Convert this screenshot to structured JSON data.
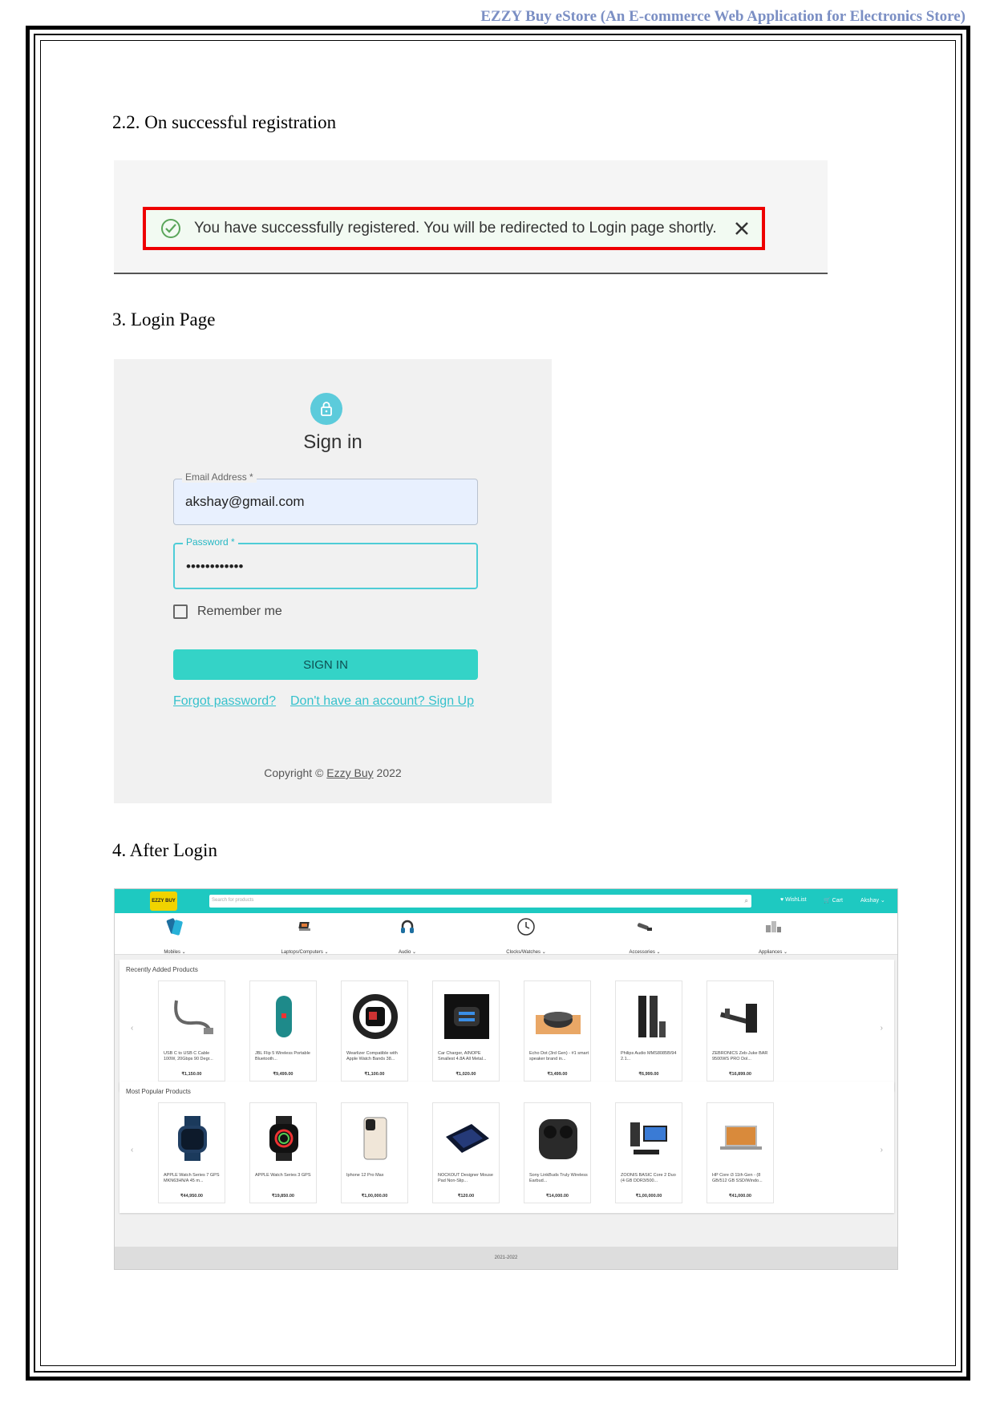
{
  "header": {
    "running_title": "EZZY Buy eStore (An E-commerce Web Application for Electronics Store)"
  },
  "sections": {
    "registration": {
      "heading": "2.2. On successful registration",
      "alert_message": "You have successfully registered. You will be redirected to Login page shortly."
    },
    "login": {
      "heading": "3. Login Page",
      "title": "Sign in",
      "email_label": "Email Address *",
      "email_value": "akshay@gmail.com",
      "password_label": "Password *",
      "password_value": "••••••••••••",
      "remember_label": "Remember me",
      "signin_label": "SIGN IN",
      "forgot_link": "Forgot password?",
      "signup_link": "Don't have an account? Sign Up",
      "copyright_prefix": "Copyright ©",
      "copyright_brand": "Ezzy Buy",
      "copyright_year": "2022"
    },
    "after_login": {
      "heading": "4. After Login",
      "logo_text": "EZZY BUY",
      "search_placeholder": "Search for products",
      "nav": {
        "wishlist": "♥ WishList",
        "cart": "🛒 Cart",
        "user": "Akshay ⌄"
      },
      "categories": [
        {
          "name": "Mobiles ⌄",
          "icon": "phone-icon"
        },
        {
          "name": "Laptops/Computers ⌄",
          "icon": "laptop-icon"
        },
        {
          "name": "Audio ⌄",
          "icon": "headphone-icon"
        },
        {
          "name": "Clocks/Watches ⌄",
          "icon": "clock-icon"
        },
        {
          "name": "Accessories ⌄",
          "icon": "accessory-icon"
        },
        {
          "name": "Appliances ⌄",
          "icon": "appliance-icon"
        }
      ],
      "recent_title": "Recently Added Products",
      "recent": [
        {
          "name": "USB C to USB C Cable 100W, 20Gbps 90 Degr...",
          "price": "₹1,150.00"
        },
        {
          "name": "JBL Flip 5 Wireless Portable Bluetooth...",
          "price": "₹9,499.00"
        },
        {
          "name": "Wearlizer Compatible with Apple Watch Bands 38...",
          "price": "₹1,100.00"
        },
        {
          "name": "Car Charger, AINOPE Smallest 4.8A All Metal...",
          "price": "₹1,020.00"
        },
        {
          "name": "Echo Dot (3rd Gen) - #1 smart speaker brand in...",
          "price": "₹3,499.00"
        },
        {
          "name": "Philips Audio MMS8085B/94 2.1...",
          "price": "₹6,999.00"
        },
        {
          "name": "ZEBRONICS Zeb-Juke BAR 9500WS PRO Dol...",
          "price": "₹16,899.00"
        }
      ],
      "popular_title": "Most Popular Products",
      "popular": [
        {
          "name": "APPLE Watch Series 7 GPS MKN63HN/A 45 m...",
          "price": "₹44,950.00"
        },
        {
          "name": "APPLE Watch Series 3 GPS",
          "price": "₹19,850.00"
        },
        {
          "name": "Iphone 12 Pro Max",
          "price": "₹1,00,000.00"
        },
        {
          "name": "NOCKOUT Designer Mouse Pad Non-Slip...",
          "price": "₹120.00"
        },
        {
          "name": "Sony LinkBuds Truly Wireless Earbud...",
          "price": "₹14,000.00"
        },
        {
          "name": "ZOONIS BASIC Core 2 Duo (4 GB DDR3/500...",
          "price": "₹1,00,000.00"
        },
        {
          "name": "HP Core i3 11th Gen - (8 GB/512 GB SSD/Windo...",
          "price": "₹41,000.00"
        }
      ],
      "footer": "2021-2022"
    }
  },
  "colors": {
    "accent": "#1ec9c1",
    "alert_border": "#e00000",
    "link": "#35c1cc",
    "header_text": "#7b8fc4"
  }
}
